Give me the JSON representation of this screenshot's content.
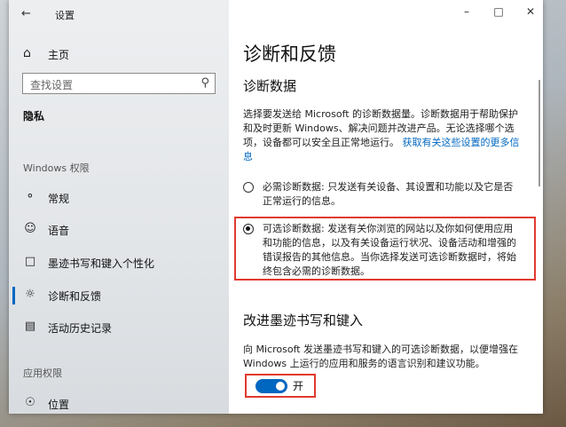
{
  "window": {
    "title": "设置"
  },
  "sidebar": {
    "home": "主页",
    "search_placeholder": "查找设置",
    "section": "隐私",
    "group1": "Windows 权限",
    "items": [
      {
        "label": "常规",
        "icon": "lock-icon"
      },
      {
        "label": "语音",
        "icon": "speech-icon"
      },
      {
        "label": "墨迹书写和键入个性化",
        "icon": "handwriting-icon"
      },
      {
        "label": "诊断和反馈",
        "icon": "diagnostics-icon"
      },
      {
        "label": "活动历史记录",
        "icon": "activity-history-icon"
      }
    ],
    "group2": "应用权限",
    "items2": [
      {
        "label": "位置",
        "icon": "location-icon"
      }
    ]
  },
  "main": {
    "title": "诊断和反馈",
    "diag_heading": "诊断数据",
    "diag_desc": "选择要发送给 Microsoft 的诊断数据量。诊断数据用于帮助保护和及时更新 Windows、解决问题并改进产品。无论选择哪个选项，设备都可以安全且正常地运行。",
    "diag_link": "获取有关这些设置的更多信息",
    "radio_required": "必需诊断数据: 只发送有关设备、其设置和功能以及它是否正常运行的信息。",
    "radio_optional": "可选诊断数据: 发送有关你浏览的网站以及你如何使用应用和功能的信息，以及有关设备运行状况、设备活动和增强的错误报告的其他信息。当你选择发送可选诊断数据时，将始终包含必需的诊断数据。",
    "ink_heading": "改进墨迹书写和键入",
    "ink_desc": "向 Microsoft 发送墨迹书写和键入的可选诊断数据，以便增强在 Windows 上运行的应用和服务的语言识别和建议功能。",
    "toggle_label": "开",
    "toggle_on": true,
    "selected_option": "optional"
  },
  "colors": {
    "accent": "#0067c0",
    "highlight": "#e03a2f"
  }
}
